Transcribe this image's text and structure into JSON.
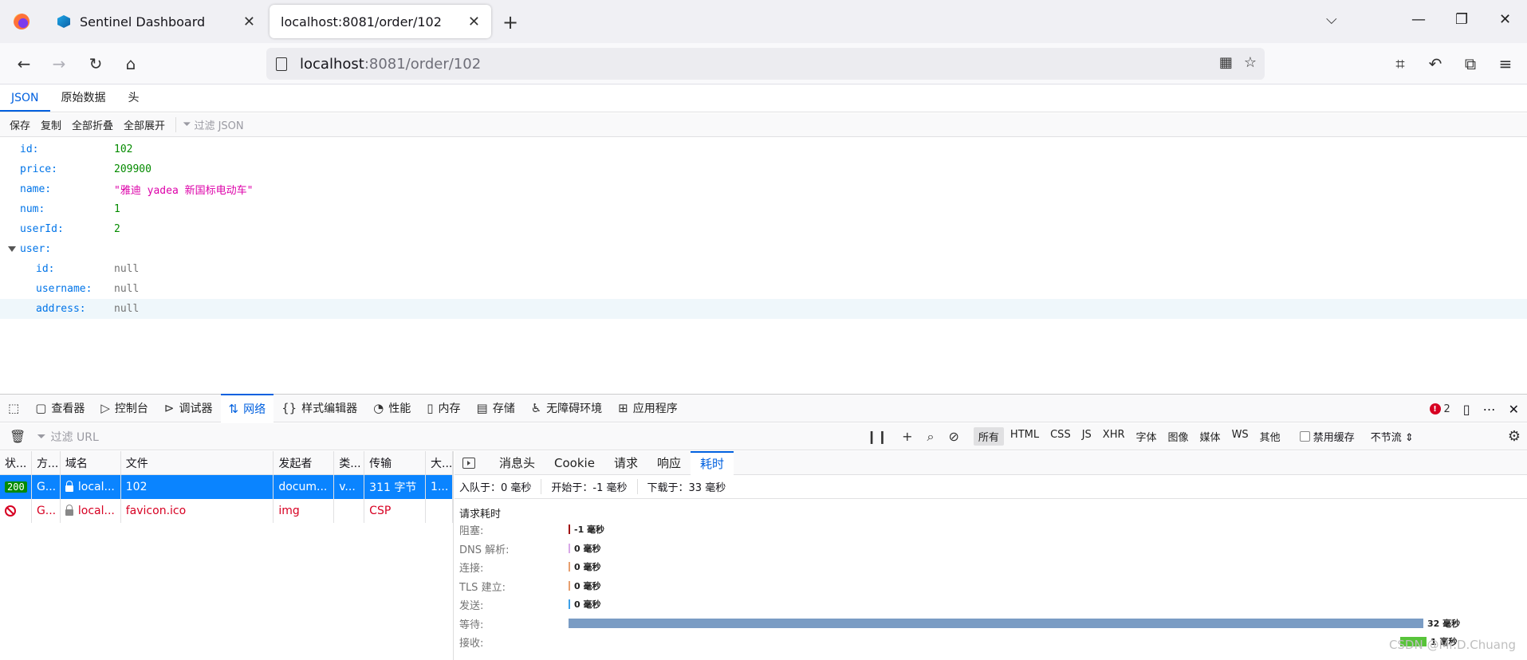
{
  "browser": {
    "tabs": [
      {
        "title": "Sentinel Dashboard",
        "active": false
      },
      {
        "title": "localhost:8081/order/102",
        "active": true
      }
    ],
    "url_host": "localhost",
    "url_path": ":8081/order/102",
    "colors": {
      "accent": "#0060df",
      "selected_row": "#0a84ff",
      "error": "#d70022",
      "ok": "#058b00"
    }
  },
  "json_viewer": {
    "tabs": [
      "JSON",
      "原始数据",
      "头"
    ],
    "toolbar": {
      "save": "保存",
      "copy": "复制",
      "collapse_all": "全部折叠",
      "expand_all": "全部展开",
      "filter_placeholder": "过滤 JSON"
    },
    "rows": [
      {
        "key": "id:",
        "value": "102"
      },
      {
        "key": "price:",
        "value": "209900"
      },
      {
        "key": "name:",
        "value": "\"雅迪 yadea 新国标电动车\""
      },
      {
        "key": "num:",
        "value": "1"
      },
      {
        "key": "userId:",
        "value": "2"
      },
      {
        "key": "user:",
        "value": ""
      },
      {
        "key": "id:",
        "value": "null"
      },
      {
        "key": "username:",
        "value": "null"
      },
      {
        "key": "address:",
        "value": "null"
      }
    ]
  },
  "devtools": {
    "tabs": [
      "查看器",
      "控制台",
      "调试器",
      "网络",
      "样式编辑器",
      "性能",
      "内存",
      "存储",
      "无障碍环境",
      "应用程序"
    ],
    "error_count": "2",
    "network": {
      "filter_placeholder": "过滤 URL",
      "type_filters": [
        "所有",
        "HTML",
        "CSS",
        "JS",
        "XHR",
        "字体",
        "图像",
        "媒体",
        "WS",
        "其他"
      ],
      "disable_cache": "禁用缓存",
      "throttle": "不节流 ⇕",
      "columns": [
        "状...",
        "方...",
        "域名",
        "文件",
        "发起者",
        "类...",
        "传输",
        "大..."
      ],
      "requests": [
        {
          "status": "200",
          "method": "G...",
          "domain": "local...",
          "file": "102",
          "initiator": "docum...",
          "type": "v...",
          "transfer": "311 字节",
          "size": "1..."
        },
        {
          "status": "",
          "method": "G...",
          "domain": "local...",
          "file": "favicon.ico",
          "initiator": "img",
          "type": "",
          "transfer": "CSP",
          "size": ""
        }
      ],
      "detail": {
        "tabs": [
          "消息头",
          "Cookie",
          "请求",
          "响应",
          "耗时"
        ],
        "summary": {
          "queued": "入队于：0 毫秒",
          "started": "开始于：-1 毫秒",
          "downloaded": "下载于：33 毫秒"
        },
        "timing_title": "请求耗时",
        "timings": [
          {
            "label": "阻塞:",
            "value": "-1 毫秒",
            "ms": 0,
            "color": "#a01010"
          },
          {
            "label": "DNS 解析:",
            "value": "0 毫秒",
            "ms": 0,
            "color": "#d8a8e8"
          },
          {
            "label": "连接:",
            "value": "0 毫秒",
            "ms": 0,
            "color": "#e8a070"
          },
          {
            "label": "TLS 建立:",
            "value": "0 毫秒",
            "ms": 0,
            "color": "#e8a070"
          },
          {
            "label": "发送:",
            "value": "0 毫秒",
            "ms": 0,
            "color": "#3da0e8"
          },
          {
            "label": "等待:",
            "value": "32 毫秒",
            "ms": 32,
            "color": "#7a9cc4"
          },
          {
            "label": "接收:",
            "value": "1 毫秒",
            "ms": 1,
            "color": "#58c43a"
          }
        ]
      }
    }
  },
  "watermark": "CSDN @Mr.D.Chuang"
}
